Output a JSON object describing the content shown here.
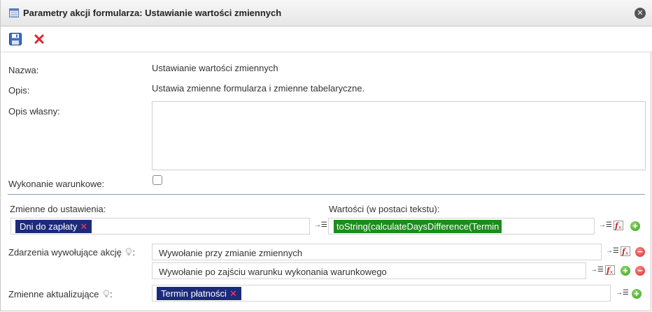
{
  "window": {
    "title": "Parametry akcji formularza: Ustawianie wartości zmiennych"
  },
  "form": {
    "name_label": "Nazwa:",
    "name_value": "Ustawianie wartości zmiennych",
    "desc_label": "Opis:",
    "desc_value": "Ustawia zmienne formularza i zmienne tabelaryczne.",
    "own_desc_label": "Opis własny:",
    "own_desc_value": "",
    "conditional_label": "Wykonanie warunkowe:",
    "conditional_checked": false
  },
  "variables": {
    "vars_label": "Zmienne do ustawienia:",
    "values_label": "Wartości (w postaci tekstu):",
    "var_tag": "Dni do zapłaty",
    "value_tag": "toString(calculateDaysDifference(Termin"
  },
  "events": {
    "label": "Zdarzenia wywołujące akcję",
    "label_suffix": ":",
    "event1": "Wywołanie przy zmianie zmiennych",
    "event2": "Wywołanie po zajściu warunku wykonania warunkowego"
  },
  "updating": {
    "label": "Zmienne aktualizujące",
    "label_suffix": ":",
    "tag": "Termin płatności"
  },
  "icons": {
    "close": "close-icon",
    "save": "save-icon",
    "cancel": "cancel-icon",
    "insert_list": "insert-list-icon",
    "function": "function-icon",
    "add": "add-icon",
    "remove": "remove-icon",
    "hint": "lightbulb-icon"
  },
  "colors": {
    "tag_bg": "#1c2a7a",
    "value_tag_bg": "#1c8c1c",
    "tag_remove": "#ff3b5a",
    "separator": "#7fa0b8"
  }
}
